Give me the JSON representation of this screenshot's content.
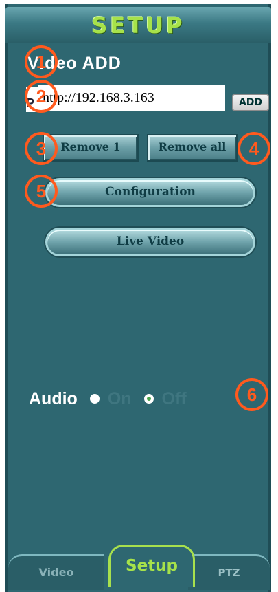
{
  "header": {
    "title": "SETUP"
  },
  "video_add": {
    "label": "Video ADD",
    "ip_prefix": "P",
    "url_value": "http://192.168.3.163",
    "add_label": "ADD"
  },
  "buttons": {
    "remove_one": "Remove 1",
    "remove_all": "Remove all",
    "configuration": "Configuration",
    "live_video": "Live Video"
  },
  "audio": {
    "label": "Audio",
    "on_label": "On",
    "off_label": "Off",
    "selected": "Off"
  },
  "markers": [
    "1",
    "2",
    "3",
    "4",
    "5",
    "6"
  ],
  "tabs": {
    "video": "Video",
    "setup": "Setup",
    "ptz": "PTZ",
    "active": "Setup"
  },
  "colors": {
    "panel": "#2e6771",
    "accent": "#a6e24a",
    "marker": "#ff5a1e"
  }
}
